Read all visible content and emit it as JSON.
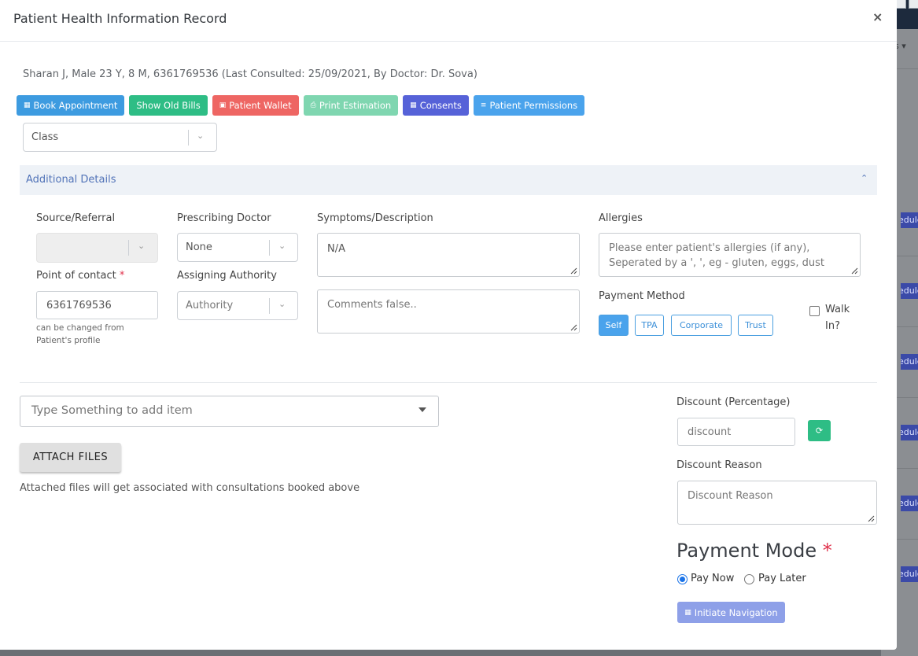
{
  "modal": {
    "title": "Patient Health Information Record",
    "close": "×"
  },
  "patient": {
    "summary": "Sharan J, Male 23 Y, 8 M, 6361769536 (Last Consulted: 25/09/2021, By Doctor: Dr. Sova)"
  },
  "actions": [
    {
      "label": "Book Appointment",
      "color": "#3d9be0",
      "icon": "calendar-icon"
    },
    {
      "label": "Show Old Bills",
      "color": "#2ebd85",
      "icon": ""
    },
    {
      "label": "Patient Wallet",
      "color": "#ee6663",
      "icon": "wallet-icon"
    },
    {
      "label": "Print Estimation",
      "color": "#7fd6b0",
      "icon": "print-icon"
    },
    {
      "label": "Consents",
      "color": "#5662d8",
      "icon": "calendar-icon"
    },
    {
      "label": "Patient Permissions",
      "color": "#4aa3ec",
      "icon": "list-icon"
    }
  ],
  "class_select": {
    "placeholder": "Class"
  },
  "additional": {
    "title": "Additional Details",
    "source_label": "Source/Referral",
    "doctor_label": "Prescribing Doctor",
    "doctor_value": "None",
    "symptoms_label": "Symptoms/Description",
    "symptoms_value": "N/A",
    "allergies_label": "Allergies",
    "allergies_placeholder": "Please enter patient's allergies (if any), Seperated by a ', ', eg - gluten, eggs, dust",
    "contact_label": "Point of contact",
    "required_mark": "*",
    "contact_value": "6361769536",
    "contact_help_1": "can be changed from",
    "contact_help_2": "Patient's profile",
    "authority_label": "Assigning Authority",
    "authority_value": "Authority",
    "comments_placeholder": "Comments false..",
    "payment_method_label": "Payment Method",
    "payment_methods": [
      "Self",
      "TPA",
      "Corporate",
      "Trust"
    ],
    "walkin_label_1": "Walk",
    "walkin_label_2": "In?"
  },
  "items": {
    "placeholder": "Type Something to add item"
  },
  "attach": {
    "button": "ATTACH FILES",
    "note": "Attached files will get associated with consultations booked above"
  },
  "discount": {
    "label": "Discount (Percentage)",
    "placeholder": "discount",
    "reason_label": "Discount Reason",
    "reason_placeholder": "Discount Reason"
  },
  "payment_mode": {
    "title": "Payment Mode",
    "required_mark": "*",
    "options": [
      "Pay Now",
      "Pay Later"
    ],
    "selected": "Pay Now"
  },
  "initiate": {
    "label": "Initiate Navigation"
  },
  "background": {
    "menu_fragment": "s ▾",
    "pill_fragment": "edule"
  }
}
